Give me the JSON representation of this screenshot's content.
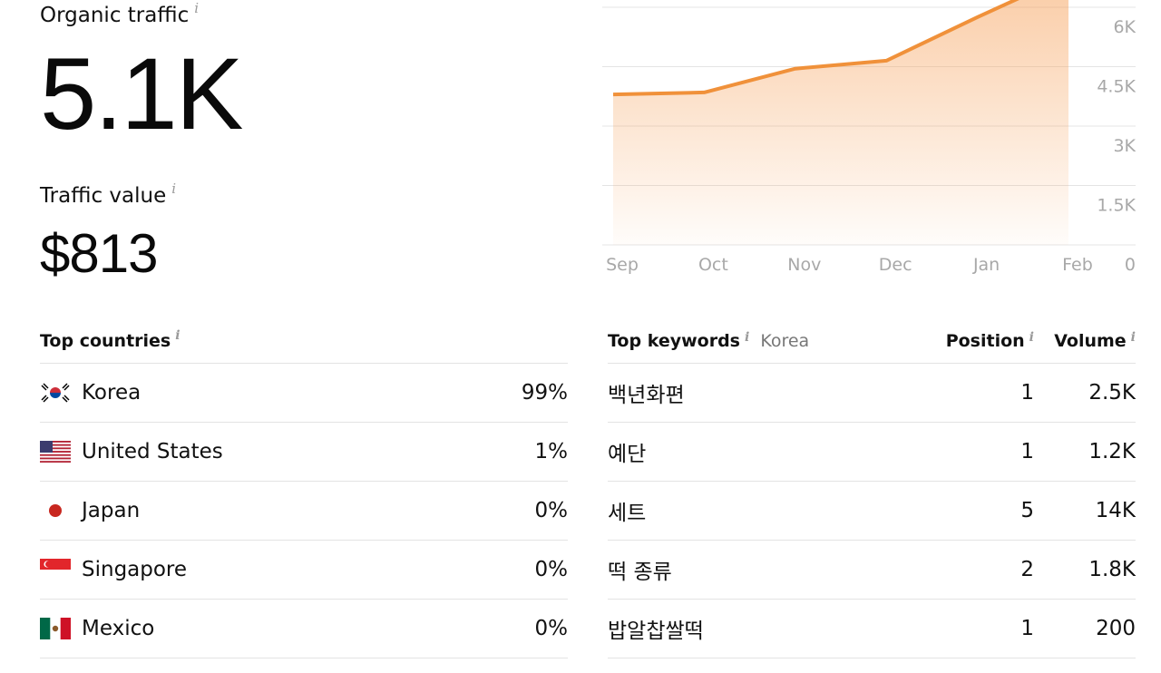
{
  "organic": {
    "label": "Organic traffic",
    "value": "5.1K",
    "info": "i"
  },
  "traffic_value": {
    "label": "Traffic value",
    "value": "$813",
    "info": "i"
  },
  "chart_data": {
    "type": "area",
    "x": [
      "Sep",
      "Oct",
      "Nov",
      "Dec",
      "Jan",
      "Feb"
    ],
    "y": [
      3.8,
      3.85,
      4.45,
      4.65,
      5.75,
      6.8
    ],
    "y_unit": "K",
    "y_ticks": [
      "6K",
      "4.5K",
      "3K",
      "1.5K",
      "0"
    ],
    "ylim": [
      0,
      6
    ],
    "grid": true,
    "line_color": "#f0913a",
    "fill_color": "#f6a15a"
  },
  "countries": {
    "title": "Top countries",
    "info": "i",
    "rows": [
      {
        "name": "Korea",
        "share": "99%",
        "flag": "korea-flag-icon"
      },
      {
        "name": "United States",
        "share": "1%",
        "flag": "usa-flag-icon"
      },
      {
        "name": "Japan",
        "share": "0%",
        "flag": "japan-flag-icon"
      },
      {
        "name": "Singapore",
        "share": "0%",
        "flag": "singapore-flag-icon"
      },
      {
        "name": "Mexico",
        "share": "0%",
        "flag": "mexico-flag-icon"
      }
    ]
  },
  "keywords": {
    "title": "Top keywords",
    "info": "i",
    "country": "Korea",
    "position_header": "Position",
    "volume_header": "Volume",
    "rows": [
      {
        "keyword": "백년화편",
        "position": "1",
        "volume": "2.5K"
      },
      {
        "keyword": "예단",
        "position": "1",
        "volume": "1.2K"
      },
      {
        "keyword": "세트",
        "position": "5",
        "volume": "14K"
      },
      {
        "keyword": "떡 종류",
        "position": "2",
        "volume": "1.8K"
      },
      {
        "keyword": "밥알찹쌀떡",
        "position": "1",
        "volume": "200"
      }
    ]
  }
}
